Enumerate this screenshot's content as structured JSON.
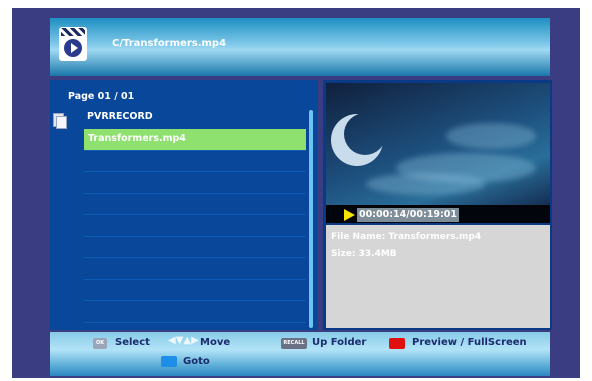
{
  "header": {
    "path": "C/Transformers.mp4",
    "icon": "video-clapper-icon"
  },
  "file_list": {
    "page_label": "Page  01 / 01",
    "folder": {
      "name": "PVRRECORD",
      "icon": "folder-icon"
    },
    "rows": [
      "Transformers.mp4",
      "",
      "",
      "",
      "",
      "",
      "",
      "",
      "",
      ""
    ],
    "selected_index": 0
  },
  "preview": {
    "time": "00:00:14/00:19:01",
    "play_icon": "play-icon",
    "progress": 0.012
  },
  "info": {
    "file_name": "File Name: Transformers.mp4",
    "size": "Size: 33.4MB"
  },
  "footer": {
    "select": {
      "key": "OK",
      "label": "Select"
    },
    "move": {
      "label": "Move",
      "icon": "arrows-icon"
    },
    "up_folder": {
      "key": "RECALL",
      "label": "Up Folder"
    },
    "preview": {
      "key_color": "#e01010",
      "label": "Preview / FullScreen"
    },
    "goto": {
      "key_color": "#1e8fe8",
      "label": "Goto"
    }
  },
  "colors": {
    "selected_row": "#8ee06f",
    "list_bg": "#08479a",
    "frame": "#3b3d82"
  }
}
